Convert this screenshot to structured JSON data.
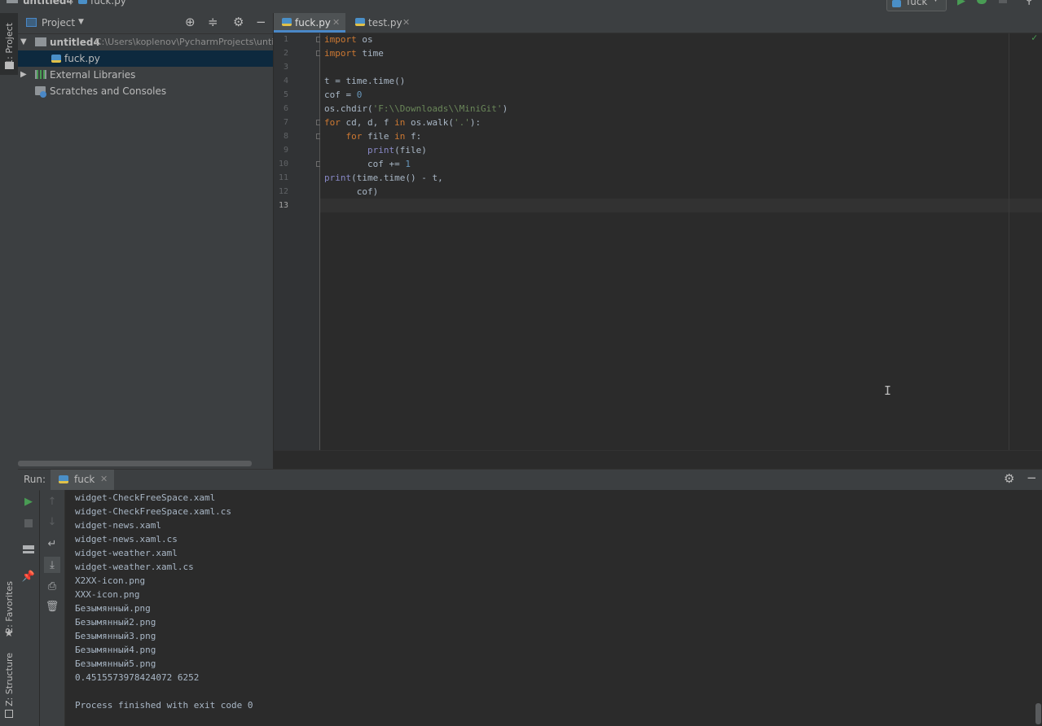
{
  "navbar": {
    "crumb_project": "untitled4",
    "crumb_file": "fuck.py",
    "run_config": "fuck"
  },
  "sidebar_tabs": {
    "project": "1: Project",
    "favorites": "2: Favorites",
    "structure": "Z: Structure"
  },
  "project_panel": {
    "title": "Project",
    "tree": [
      {
        "label": "untitled4",
        "path": "C:\\Users\\koplenov\\PycharmProjects\\untitl"
      },
      {
        "label": "fuck.py"
      },
      {
        "label": "External Libraries"
      },
      {
        "label": "Scratches and Consoles"
      }
    ]
  },
  "editor": {
    "tabs": [
      {
        "label": "fuck.py"
      },
      {
        "label": "test.py"
      }
    ],
    "line_numbers": [
      "1",
      "2",
      "3",
      "4",
      "5",
      "6",
      "7",
      "8",
      "9",
      "10",
      "11",
      "12",
      "13"
    ]
  },
  "run_panel": {
    "label": "Run:",
    "tab": "fuck",
    "output": [
      "widget-CheckFreeSpace.xaml",
      "widget-CheckFreeSpace.xaml.cs",
      "widget-news.xaml",
      "widget-news.xaml.cs",
      "widget-weather.xaml",
      "widget-weather.xaml.cs",
      "X2XX-icon.png",
      "XXX-icon.png",
      "Безымянный.png",
      "Безымянный2.png",
      "Безымянный3.png",
      "Безымянный4.png",
      "Безымянный5.png",
      "0.4515573978424072 6252",
      "",
      "Process finished with exit code 0"
    ]
  },
  "colors": {
    "keyword": "#cc7832",
    "number": "#6897bb",
    "string": "#6a8759",
    "builtin": "#8888c6",
    "selection": "#0d293e",
    "run_green": "#499c54"
  }
}
